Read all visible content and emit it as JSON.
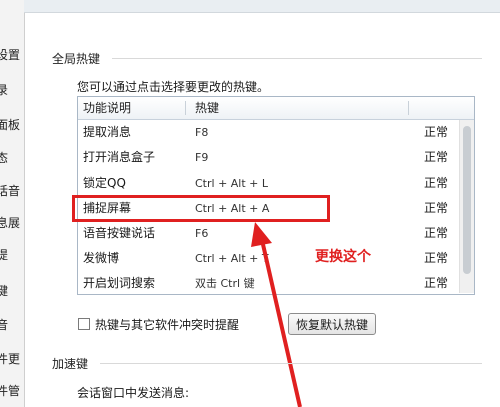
{
  "side_tabs": [
    "设置",
    "录",
    "面板",
    "态",
    "话音",
    "息展",
    "提",
    "键",
    "音",
    "件更",
    "件管"
  ],
  "section_global": "全局热键",
  "section_accel": "加速键",
  "description": "您可以通过点击选择要更改的热键。",
  "table": {
    "headers": [
      "功能说明",
      "热键"
    ],
    "rows": [
      {
        "func": "提取消息",
        "key": "F8",
        "status": "正常"
      },
      {
        "func": "打开消息盒子",
        "key": "F9",
        "status": "正常"
      },
      {
        "func": "锁定QQ",
        "key": "Ctrl + Alt + L",
        "status": "正常"
      },
      {
        "func": "捕捉屏幕",
        "key": "Ctrl + Alt + A",
        "status": "正常"
      },
      {
        "func": "语音按键说话",
        "key": "F6",
        "status": "正常"
      },
      {
        "func": "发微博",
        "key": "Ctrl + Alt + T",
        "status": "正常"
      },
      {
        "func": "开启划词搜索",
        "key": "双击 Ctrl 键",
        "status": "正常"
      }
    ]
  },
  "conflict_checkbox_label": "热键与其它软件冲突时提醒",
  "restore_button": "恢复默认热键",
  "annotation": "更换这个",
  "bottom_label": "会话窗口中发送消息:",
  "colors": {
    "annotation_red": "#e02020",
    "list_border": "#a9b7c6"
  }
}
